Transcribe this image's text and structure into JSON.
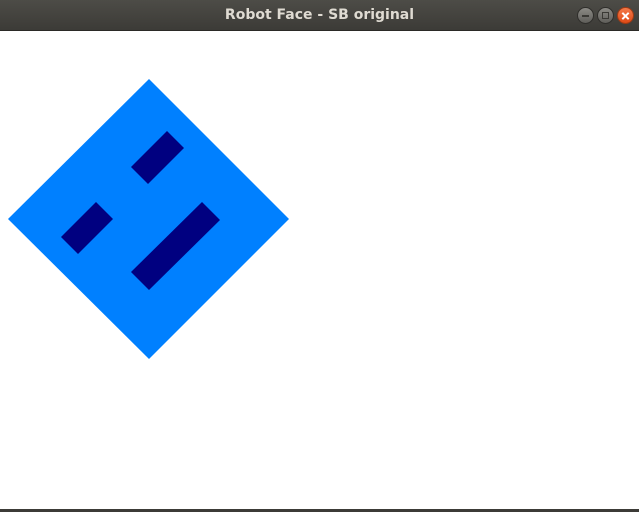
{
  "window": {
    "title": "Robot Face - SB original",
    "controls": [
      {
        "name": "minimize-icon"
      },
      {
        "name": "maximize-icon"
      },
      {
        "name": "close-icon"
      }
    ]
  },
  "colors": {
    "face": "#0080ff",
    "features": "#000080",
    "background": "#ffffff"
  },
  "robot_face": {
    "shape": "rotated square",
    "features": [
      "left-eye",
      "right-eye",
      "mouth"
    ]
  }
}
